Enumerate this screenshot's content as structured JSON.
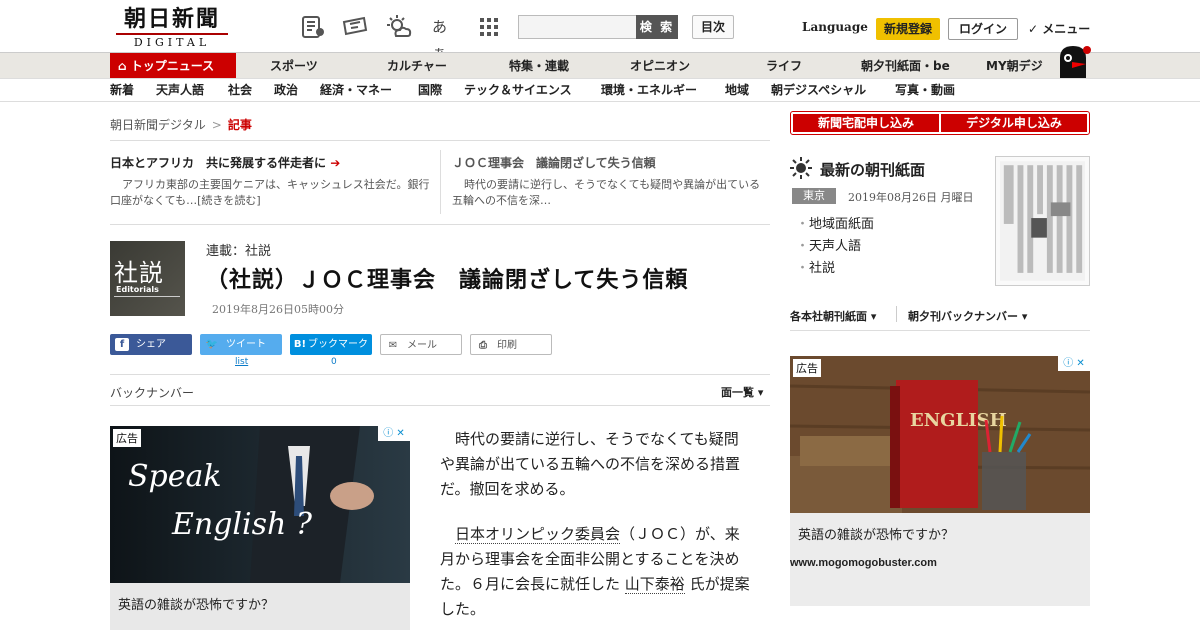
{
  "header": {
    "logo_jp": "朝日新聞",
    "logo_en": "DIGITAL",
    "search_button": "検 索",
    "contents_button": "目次",
    "language": "Language",
    "signup": "新規登録",
    "login": "ログイン",
    "menu": "✓ メニュー",
    "font_toggle": "あぁ"
  },
  "nav_main": [
    "トップニュース",
    "スポーツ",
    "カルチャー",
    "特集・連載",
    "オピニオン",
    "ライフ",
    "朝夕刊紙面・be",
    "MY朝デジ"
  ],
  "nav_sub": [
    "新着",
    "天声人語",
    "社会",
    "政治",
    "経済・マネー",
    "国際",
    "テック＆サイエンス",
    "環境・エネルギー",
    "地域",
    "朝デジスペシャル",
    "写真・動画"
  ],
  "breadcrumb": {
    "home": "朝日新聞デジタル",
    "sep": ">",
    "current": "記事"
  },
  "related": [
    {
      "title": "日本とアフリカ　共に発展する伴走者に",
      "desc": "アフリカ東部の主要国ケニアは、キャッシュレス社会だ。銀行口座がなくても…[続きを読む]"
    },
    {
      "title": "ＪＯＣ理事会　議論閉ざして失う信頼",
      "desc": "時代の要請に逆行し、そうでなくても疑問や異論が出ている五輪への不信を深…"
    }
  ],
  "article": {
    "thumb_kanji": "社説",
    "thumb_en": "Editorials",
    "series": "連載：社説",
    "title": "（社説）ＪＯＣ理事会　議論閉ざして失う信頼",
    "date": "2019年8月26日05時00分",
    "p1": "時代の要請に逆行し、そうでなくても疑問や異論が出ている五輪への不信を深める措置だ。撤回を求める。",
    "p2_link1": "日本オリンピック委員会",
    "p2_a": "（ＪＯＣ）が、来月から理事会を全面非公開とすることを決めた。６月に会長に就任した",
    "p2_link2": "山下泰裕",
    "p2_b": "氏が提案した。"
  },
  "share": {
    "facebook": "シェア",
    "twitter": "ツイート",
    "twitter_sub": "list",
    "hatena": "ブックマーク",
    "hatena_icon": "B!",
    "hatena_count": "0",
    "mail": "メール",
    "print": "印刷"
  },
  "backnumber": "バックナンバー",
  "page_list": "面一覧",
  "ads": {
    "tag": "広告",
    "left_img_text1": "Speak",
    "left_img_text2": "English ?",
    "left_caption": "英語の雑談が恐怖ですか？",
    "right_book": "ENGLISH",
    "right_caption": "英語の雑談が恐怖ですか？",
    "right_url": "www.mogomogobuster.com"
  },
  "sidebar": {
    "btn_home": "新聞宅配申し込み",
    "btn_digital": "デジタル申し込み",
    "morning_title": "最新の朝刊紙面",
    "city": "東京",
    "morning_date": "2019年08月26日 月曜日",
    "links": [
      "地域面紙面",
      "天声人語",
      "社説"
    ],
    "dropdown1": "各本社朝刊紙面",
    "dropdown2": "朝夕刊バックナンバー"
  },
  "colors": {
    "brand_red": "#cc0000",
    "signup_yellow": "#f0c000",
    "facebook": "#3b5998",
    "twitter": "#55acee",
    "hatena": "#008fde"
  }
}
